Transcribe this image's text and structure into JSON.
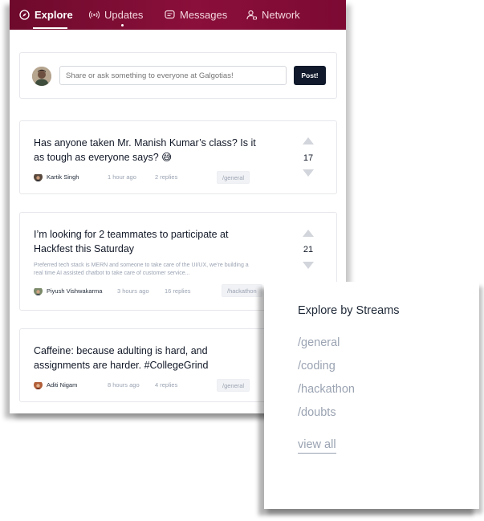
{
  "nav": {
    "items": [
      {
        "label": "Explore",
        "icon": "compass-icon"
      },
      {
        "label": "Updates",
        "icon": "broadcast-icon"
      },
      {
        "label": "Messages",
        "icon": "message-icon"
      },
      {
        "label": "Network",
        "icon": "user-network-icon"
      }
    ]
  },
  "composer": {
    "placeholder": "Share or ask something to everyone at Galgotias!",
    "post_label": "Post!"
  },
  "posts": [
    {
      "title": "Has anyone taken Mr. Manish Kumar’s class? Is it as tough as everyone says? 😅",
      "excerpt": "",
      "author": "Kartik Singh",
      "time": "1 hour ago",
      "replies": "2 replies",
      "tag": "/general",
      "votes": "17"
    },
    {
      "title": "I’m looking for 2 teammates to participate at Hackfest this Saturday",
      "excerpt": "Preferred tech stack is MERN and someone to take care of the UI/UX, we’re building a real time AI assisted chatbot to take care of customer service...",
      "author": "Piyush Vishwakarma",
      "time": "3 hours ago",
      "replies": "16 replies",
      "tag": "/hackathon",
      "votes": "21"
    },
    {
      "title": "Caffeine: because adulting is hard, and assignments are harder. #CollegeGrind",
      "excerpt": "",
      "author": "Aditi Nigam",
      "time": "8 hours ago",
      "replies": "4 replies",
      "tag": "/general",
      "votes": ""
    }
  ],
  "streams": {
    "title": "Explore by Streams",
    "links": [
      "/general",
      "/coding",
      "/hackathon",
      "/doubts"
    ],
    "view_all": "view all"
  },
  "colors": {
    "brand": "#7c0a33",
    "post_button": "#101a2c",
    "muted_text": "#9aa3b2"
  }
}
